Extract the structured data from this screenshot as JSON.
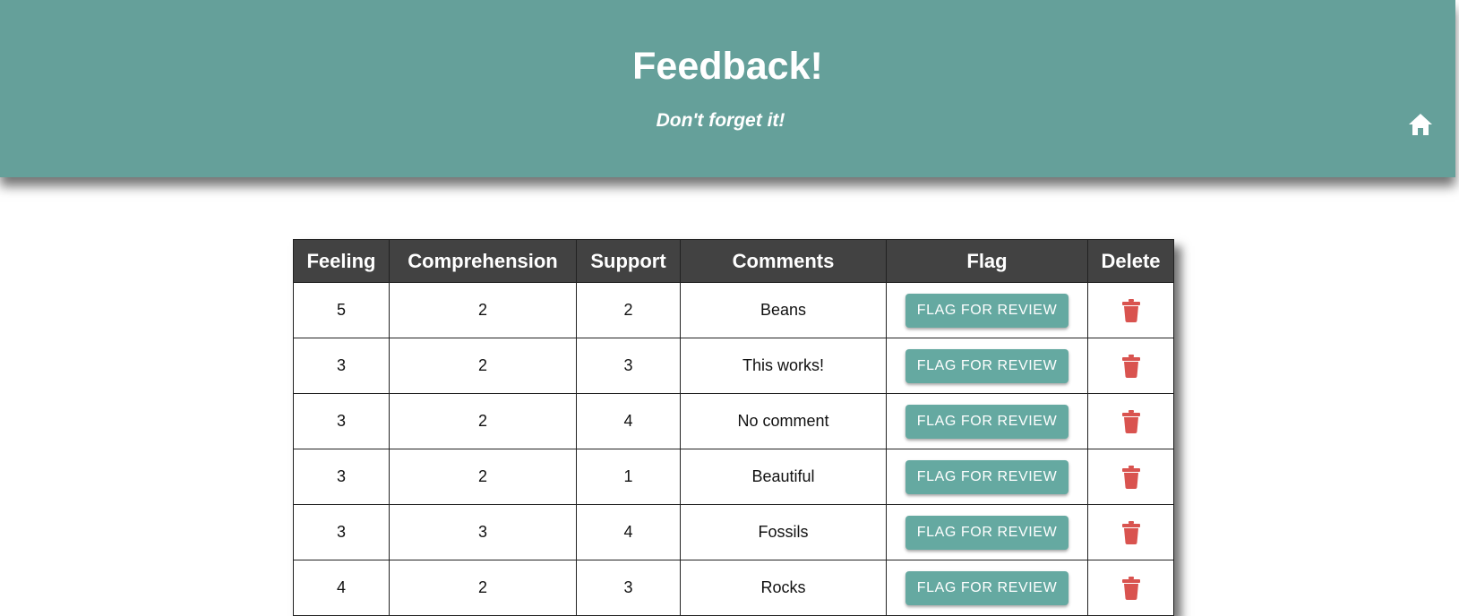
{
  "header": {
    "title": "Feedback!",
    "subtitle": "Don't forget it!",
    "home_icon": "home-icon"
  },
  "table": {
    "columns": [
      "Feeling",
      "Comprehension",
      "Support",
      "Comments",
      "Flag",
      "Delete"
    ],
    "flag_label": "FLAG FOR REVIEW",
    "delete_icon": "trash-icon",
    "rows": [
      {
        "feeling": "5",
        "comprehension": "2",
        "support": "2",
        "comments": "Beans"
      },
      {
        "feeling": "3",
        "comprehension": "2",
        "support": "3",
        "comments": "This works!"
      },
      {
        "feeling": "3",
        "comprehension": "2",
        "support": "4",
        "comments": "No comment"
      },
      {
        "feeling": "3",
        "comprehension": "2",
        "support": "1",
        "comments": "Beautiful"
      },
      {
        "feeling": "3",
        "comprehension": "3",
        "support": "4",
        "comments": "Fossils"
      },
      {
        "feeling": "4",
        "comprehension": "2",
        "support": "3",
        "comments": "Rocks"
      }
    ]
  },
  "colors": {
    "header_bg": "#65a09a",
    "table_header_bg": "#424242",
    "flag_button_bg": "#65a9a1",
    "delete_icon": "#d9534f"
  }
}
